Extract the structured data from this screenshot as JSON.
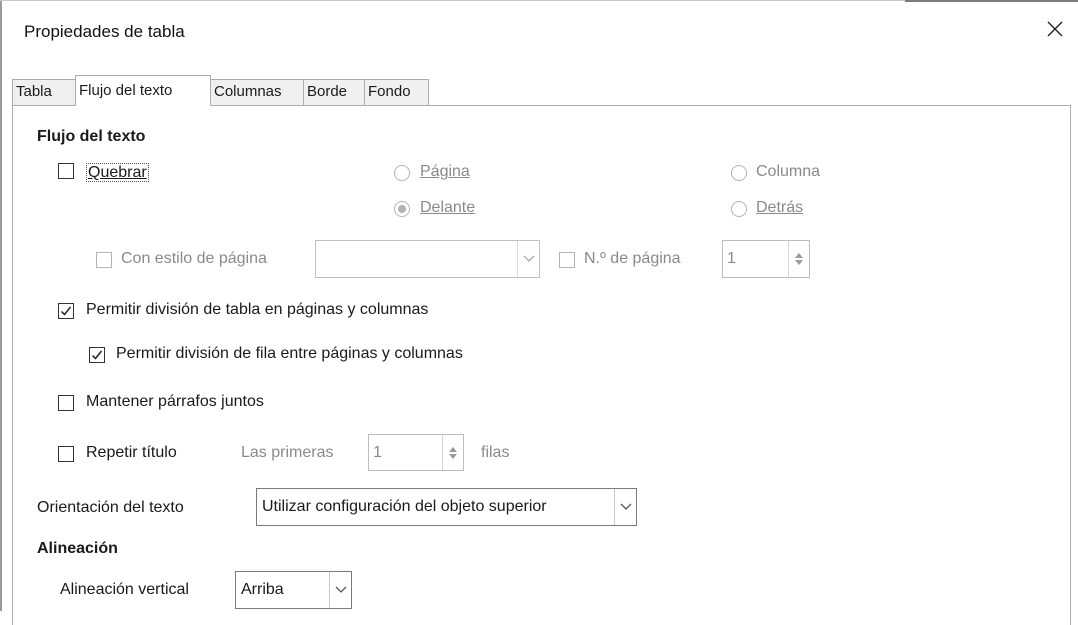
{
  "window": {
    "title": "Propiedades de tabla",
    "close_icon": "close-icon"
  },
  "tabs": [
    {
      "label": "Tabla",
      "active": false
    },
    {
      "label": "Flujo del texto",
      "active": true
    },
    {
      "label": "Columnas",
      "active": false
    },
    {
      "label": "Borde",
      "active": false
    },
    {
      "label": "Fondo",
      "active": false
    }
  ],
  "text_flow": {
    "heading": "Flujo del texto",
    "break": {
      "label": "Quebrar",
      "checked": false
    },
    "page_radio": {
      "label": "Página",
      "selected": false,
      "enabled": false
    },
    "column_radio": {
      "label": "Columna",
      "selected": false,
      "enabled": false
    },
    "before_radio": {
      "label": "Delante",
      "selected": true,
      "enabled": false
    },
    "after_radio": {
      "label": "Detrás",
      "selected": false,
      "enabled": false
    },
    "with_page_style": {
      "label": "Con estilo de página",
      "checked": false,
      "enabled": false
    },
    "page_style_value": "",
    "page_number": {
      "label": "N.º de página",
      "checked": false,
      "enabled": false,
      "value": "1"
    },
    "allow_table_split": {
      "label": "Permitir división de tabla en páginas y columnas",
      "checked": true
    },
    "allow_row_split": {
      "label": "Permitir división de fila entre páginas y columnas",
      "checked": true
    },
    "keep_together": {
      "label": "Mantener párrafos juntos",
      "checked": false
    },
    "repeat_heading": {
      "label": "Repetir título",
      "checked": false
    },
    "first_rows": {
      "label": "Las primeras",
      "value": "1",
      "suffix": "filas",
      "enabled": false
    },
    "text_orientation": {
      "label": "Orientación del texto",
      "value": "Utilizar configuración del objeto superior"
    }
  },
  "alignment": {
    "heading": "Alineación",
    "vertical": {
      "label": "Alineación vertical",
      "value": "Arriba"
    }
  }
}
